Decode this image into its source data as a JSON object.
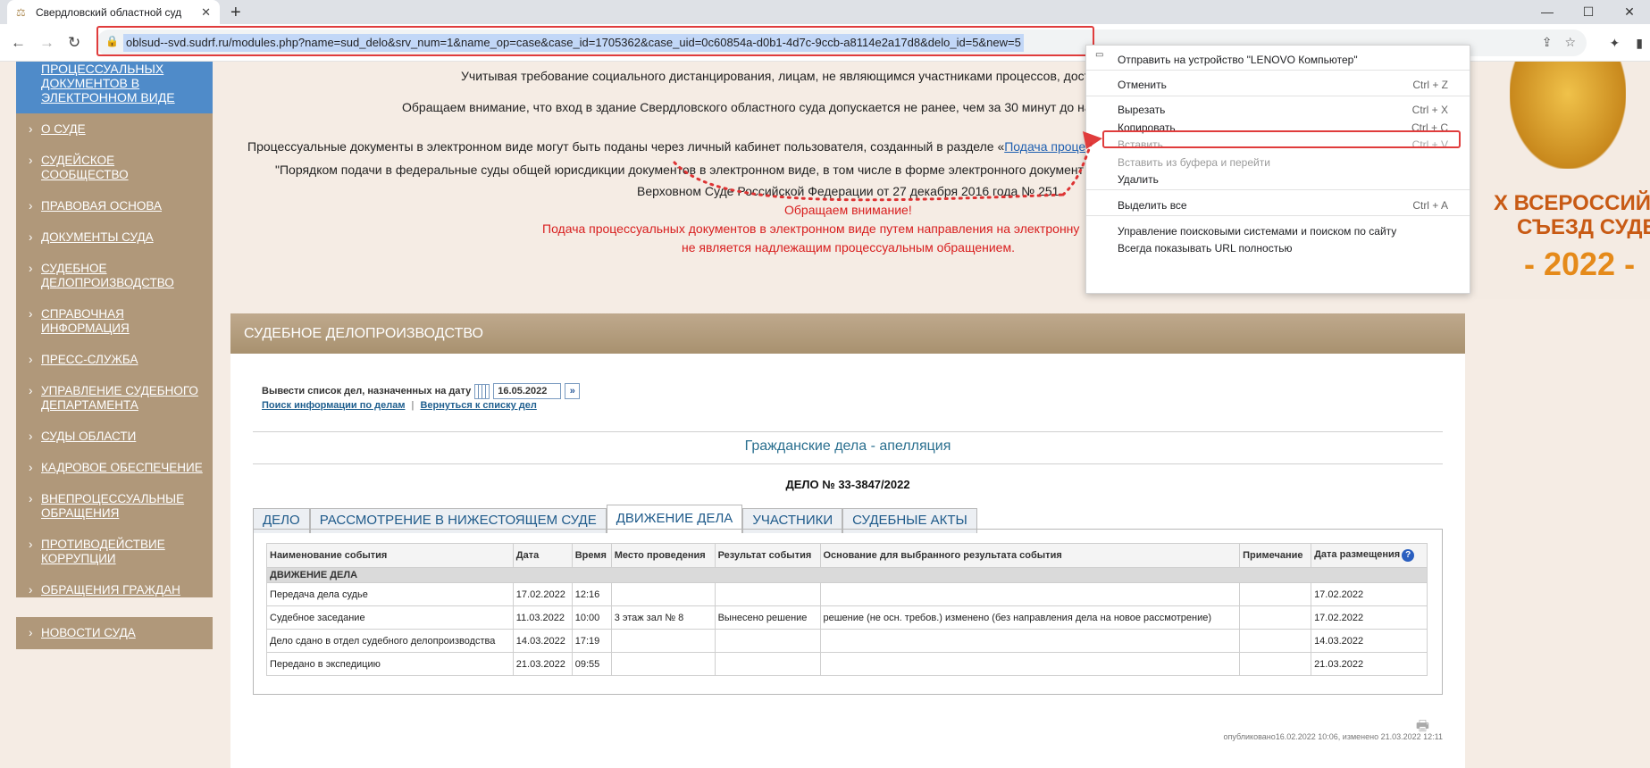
{
  "browser": {
    "tab_title": "Свердловский областной суд",
    "new_tab": "+",
    "url": "oblsud--svd.sudrf.ru/modules.php?name=sud_delo&srv_num=1&name_op=case&case_id=1705362&case_uid=0c60854a-d0b1-4d7c-9ccb-a8114e2a17d8&delo_id=5&new=5",
    "win_minimize": "—",
    "win_maximize": "☐",
    "win_close": "✕"
  },
  "sidebar": {
    "top_item": "ПРОЦЕССУАЛЬНЫХ ДОКУМЕНТОВ В ЭЛЕКТРОННОМ ВИДЕ",
    "items": [
      "О СУДЕ",
      "СУДЕЙСКОЕ СООБЩЕСТВО",
      "ПРАВОВАЯ ОСНОВА",
      "ДОКУМЕНТЫ СУДА",
      "СУДЕБНОЕ ДЕЛОПРОИЗВОДСТВО",
      "СПРАВОЧНАЯ ИНФОРМАЦИЯ",
      "ПРЕСС-СЛУЖБА",
      "УПРАВЛЕНИЕ СУДЕБНОГО ДЕПАРТАМЕНТА",
      "СУДЫ ОБЛАСТИ",
      "КАДРОВОЕ ОБЕСПЕЧЕНИЕ",
      "ВНЕПРОЦЕССУАЛЬНЫЕ ОБРАЩЕНИЯ",
      "ПРОТИВОДЕЙСТВИЕ КОРРУПЦИИ",
      "ОБРАЩЕНИЯ ГРАЖДАН"
    ],
    "news": "НОВОСТИ СУДА"
  },
  "notice": {
    "line1": "Учитывая требование социального дистанцирования, лицам, не являющимся участниками процессов, доступ в",
    "line2": "Обращаем внимание, что вход в здание Свердловского областного суда допускается не ранее, чем за 30 минут до назнач",
    "line3_pre": "Процессуальные документы в электронном виде могут быть поданы через личный кабинет пользователя, созданный в разделе «",
    "line3_link": "Подача проце",
    "line4": "\"Порядком подачи в федеральные суды общей юрисдикции документов в электронном виде, в том числе в форме электронного документ",
    "line5": "Верховном Суде Российской Федерации от 27 декабря 2016 года № 251",
    "line6": "Обращаем внимание!",
    "line7": "Подача процессуальных документов в электронном виде путем направления на электронну",
    "line8": "не является надлежащим процессуальным обращением."
  },
  "banner": {
    "line1": "X ВСЕРОССИЙСКИ",
    "line2": "СЪЕЗД СУДЕЙ",
    "line3": "- 2022 -"
  },
  "panel": {
    "title": "СУДЕБНОЕ ДЕЛОПРОИЗВОДСТВО",
    "date_label": "Вывести список дел, назначенных на дату",
    "date_value": "16.05.2022",
    "link_search": "Поиск информации по делам",
    "link_sep": "|",
    "link_back": "Вернуться к списку дел",
    "category": "Гражданские дела - апелляция",
    "case_number": "ДЕЛО № 33-3847/2022",
    "tabs": [
      "ДЕЛО",
      "РАССМОТРЕНИЕ В НИЖЕСТОЯЩЕМ СУДЕ",
      "ДВИЖЕНИЕ ДЕЛА",
      "УЧАСТНИКИ",
      "СУДЕБНЫЕ АКТЫ"
    ],
    "table_caption": "ДВИЖЕНИЕ ДЕЛА",
    "columns": [
      "Наименование события",
      "Дата",
      "Время",
      "Место проведения",
      "Результат события",
      "Основание для выбранного результата события",
      "Примечание",
      "Дата размещения"
    ],
    "rows": [
      [
        "Передача дела судье",
        "17.02.2022",
        "12:16",
        "",
        "",
        "",
        "",
        "17.02.2022"
      ],
      [
        "Судебное заседание",
        "11.03.2022",
        "10:00",
        "3 этаж зал № 8",
        "Вынесено решение",
        "решение (не осн. требов.) изменено (без направления дела на новое рассмотрение)",
        "",
        "17.02.2022"
      ],
      [
        "Дело сдано в отдел судебного делопроизводства",
        "14.03.2022",
        "17:19",
        "",
        "",
        "",
        "",
        "14.03.2022"
      ],
      [
        "Передано в экспедицию",
        "21.03.2022",
        "09:55",
        "",
        "",
        "",
        "",
        "21.03.2022"
      ]
    ],
    "help": "?",
    "pubinfo": "опубликовано16.02.2022 10:06, изменено 21.03.2022 12:11"
  },
  "context_menu": {
    "items": [
      {
        "label": "Отправить на устройство \"LENOVO Компьютер\"",
        "shortcut": ""
      },
      {
        "label": "Отменить",
        "shortcut": "Ctrl + Z"
      },
      {
        "label": "Вырезать",
        "shortcut": "Ctrl + X"
      },
      {
        "label": "Копировать",
        "shortcut": "Ctrl + C"
      },
      {
        "label": "Вставить",
        "shortcut": "Ctrl + V"
      },
      {
        "label": "Вставить из буфера и перейти",
        "shortcut": ""
      },
      {
        "label": "Удалить",
        "shortcut": ""
      },
      {
        "label": "Выделить все",
        "shortcut": "Ctrl + A"
      },
      {
        "label": "Управление поисковыми системами и поиском по сайту",
        "shortcut": ""
      },
      {
        "label": "Всегда показывать URL полностью",
        "shortcut": ""
      }
    ]
  },
  "colors": {
    "annotation_red": "#e03c3c",
    "sidebar_bg": "#b0987a",
    "sidebar_active": "#4f8bc9",
    "link_blue": "#1f5fb0"
  }
}
